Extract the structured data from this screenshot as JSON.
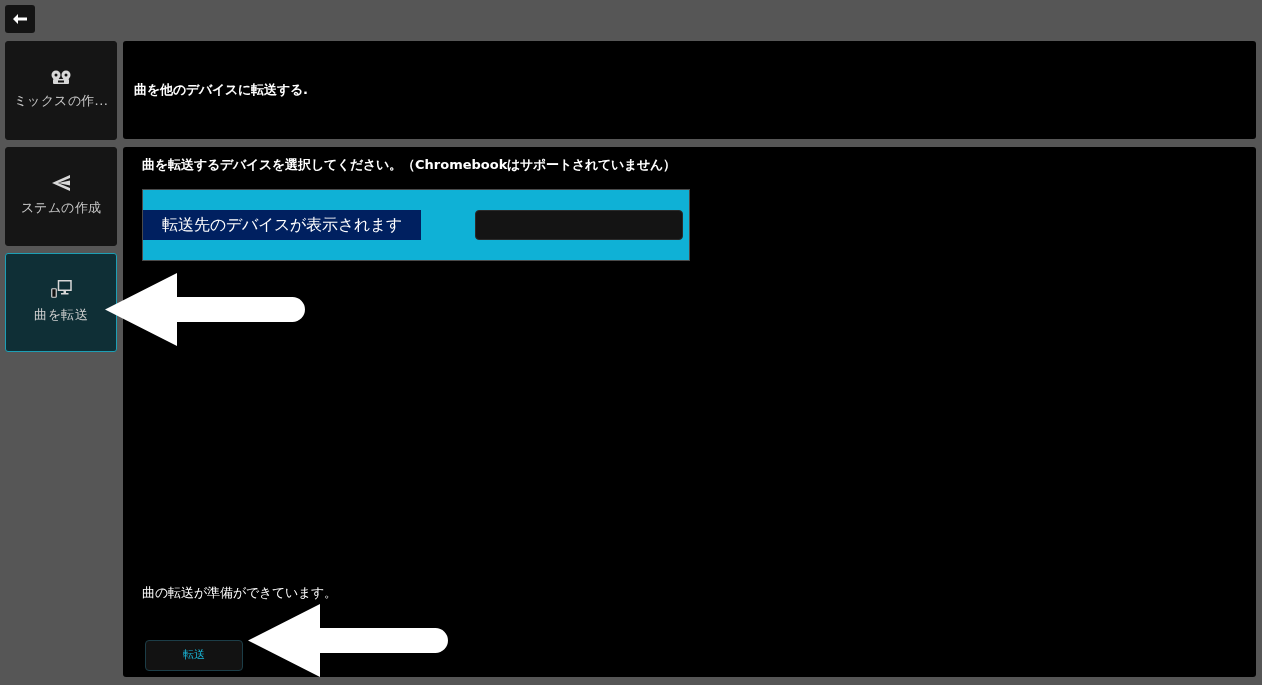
{
  "sidebar": {
    "items": [
      {
        "kind": "mix",
        "label": "ミックスの作...",
        "selected": false
      },
      {
        "kind": "stems",
        "label": "ステムの作成",
        "selected": false
      },
      {
        "kind": "transfer",
        "label": "曲を転送",
        "selected": true
      }
    ]
  },
  "header": {
    "title": "曲を他のデバイスに転送する."
  },
  "device_panel": {
    "instruction": "曲を転送するデバイスを選択してください。（Chromebookはサポートされていません）",
    "device_list": {
      "label": "転送先のデバイスが表示されます"
    }
  },
  "status": {
    "message": "曲の転送が準備ができています。"
  },
  "transfer_button": {
    "label": "転送"
  }
}
